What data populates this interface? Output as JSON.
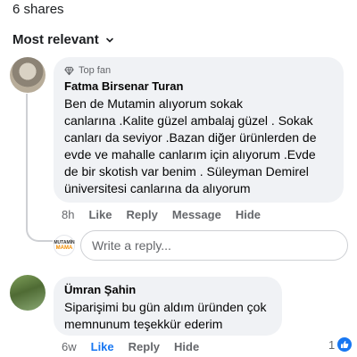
{
  "header": {
    "shares": "6 shares",
    "sort_label": "Most relevant"
  },
  "comments": [
    {
      "badge": "Top fan",
      "author": "Fatma Birsenar Turan",
      "lines": [
        "Ben de Mutamin alıyorum sokak",
        "canlarına .Kalite güzel ambalaj güzel . Sokak",
        "canları da seviyor .Bazan diğer ürünlerden de",
        "evde ve mahalle canlarım için alıyorum .Evde",
        "de bir skotish var benim . Süleyman Demirel",
        "üniversitesi canlarına da alıyorum"
      ],
      "time": "8h",
      "actions": [
        "Like",
        "Reply",
        "Message",
        "Hide"
      ]
    },
    {
      "author": "Ümran Şahin",
      "lines": [
        "Siparişimi bu gün aldım üründen çok",
        "memnunum teşekkür ederim"
      ],
      "time": "6w",
      "actions": [
        "Like",
        "Reply",
        "Hide"
      ],
      "reaction_count": "1"
    }
  ],
  "reply_box": {
    "placeholder": "Write a reply...",
    "avatar_text_1": "MUTAMİN",
    "avatar_text_2": "MAMA"
  },
  "colors": {
    "accent": "#1877f2",
    "bubble": "#f0f2f5",
    "secondary_text": "#65676b"
  },
  "icons": [
    "chevron-down-icon",
    "diamond-icon",
    "like-icon"
  ]
}
